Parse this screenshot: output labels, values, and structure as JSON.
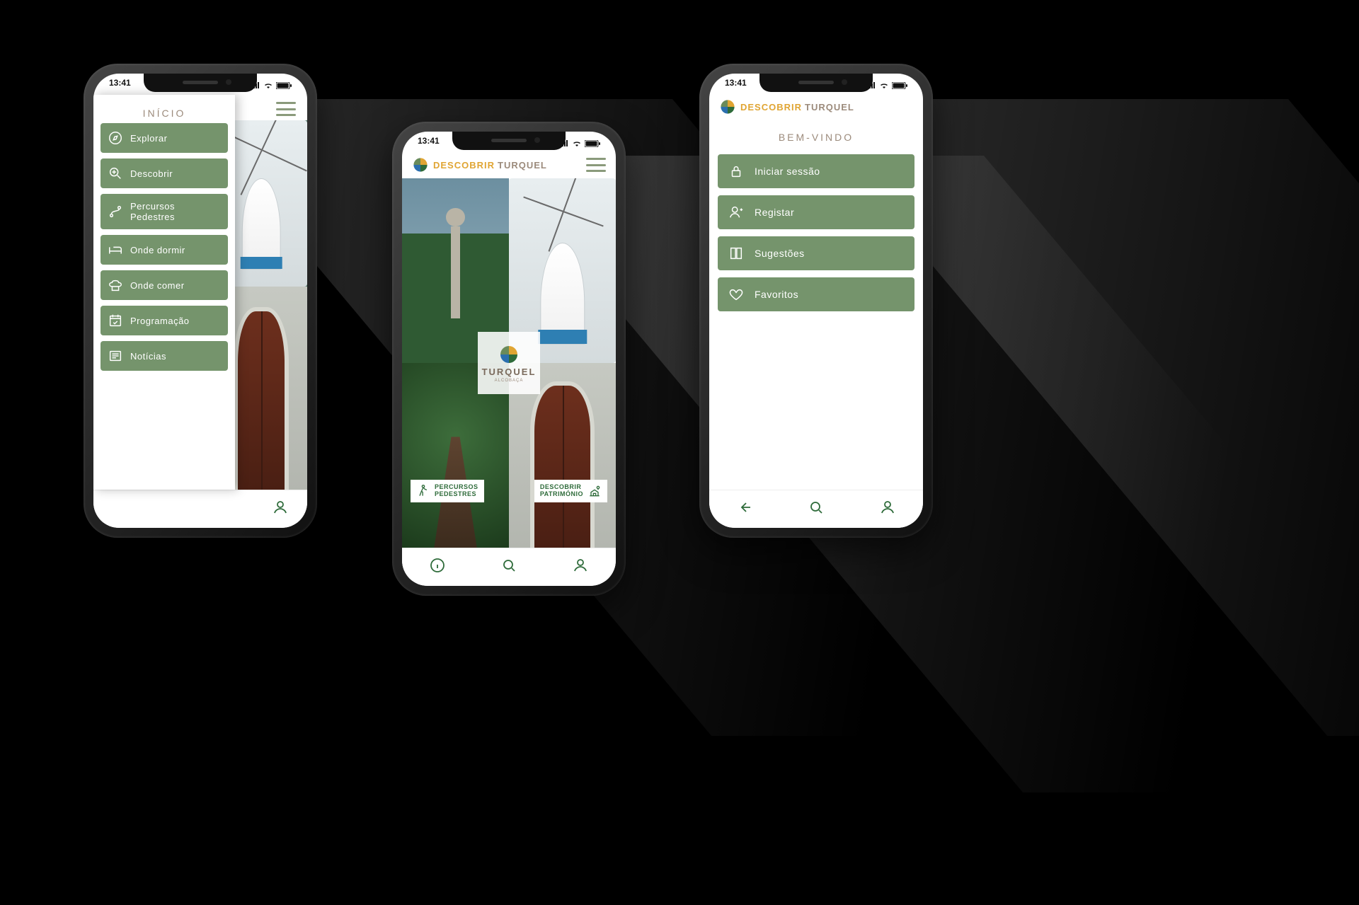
{
  "status": {
    "time": "13:41",
    "signal": "•ıll",
    "wifi": "wifi",
    "battery": "full"
  },
  "brand": {
    "descobrir": "DESCOBRIR",
    "turquel": "TURQUEL"
  },
  "centerBadge": {
    "name": "TURQUEL",
    "sub": "ALCOBAÇA"
  },
  "phone1": {
    "title": "INÍCIO",
    "items": [
      {
        "icon": "compass",
        "label": "Explorar"
      },
      {
        "icon": "search+",
        "label": "Descobrir"
      },
      {
        "icon": "route",
        "label": "Percursos Pedestres"
      },
      {
        "icon": "bed",
        "label": "Onde dormir"
      },
      {
        "icon": "chef",
        "label": "Onde comer"
      },
      {
        "icon": "calendar",
        "label": "Programação"
      },
      {
        "icon": "news",
        "label": "Notícias"
      }
    ]
  },
  "phone2": {
    "chips": [
      {
        "line1": "PERCURSOS",
        "line2": "PEDESTRES"
      },
      {
        "line1": "DESCOBRIR",
        "line2": "PATRIMÓNIO"
      }
    ]
  },
  "phone3": {
    "title": "BEM-VINDO",
    "items": [
      {
        "icon": "lock",
        "label": "Iniciar sessão"
      },
      {
        "icon": "user+",
        "label": "Registar"
      },
      {
        "icon": "book",
        "label": "Sugestões"
      },
      {
        "icon": "heart",
        "label": "Favoritos"
      }
    ]
  },
  "colors": {
    "green": "#75946c",
    "accent": "#2e6b3a",
    "gold": "#e0a533",
    "taupe": "#9c8b7c"
  }
}
